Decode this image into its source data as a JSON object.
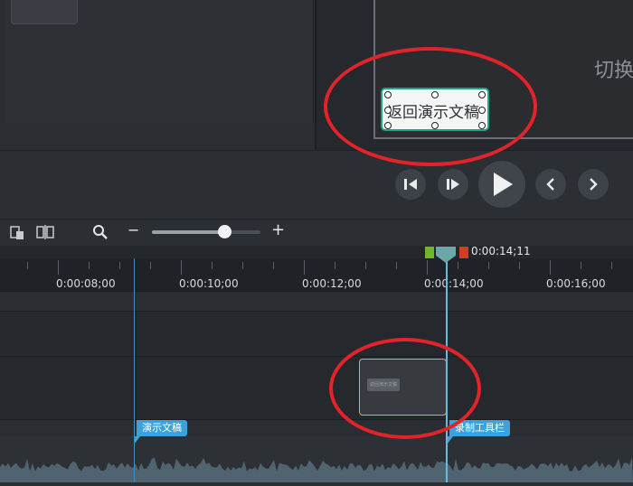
{
  "canvas": {
    "title_partial": "切换",
    "callout_text": "返回演示文稿"
  },
  "playback": {
    "prev_frame": "step-back",
    "next_frame": "step-forward",
    "play": "play",
    "prev_marker": "chevron-left",
    "next_marker": "chevron-right"
  },
  "toolbar": {
    "zoom_out_label": "−",
    "zoom_in_label": "+",
    "zoom_level": 0.62
  },
  "timeline": {
    "playhead_time": "0:00:14;11",
    "ruler_labels": [
      "0:00:08;00",
      "0:00:10;00",
      "0:00:12;00",
      "0:00:14;00",
      "0:00:16;00"
    ],
    "clip_thumb_text": "返回演示文稿",
    "markers": [
      "演示文稿",
      "录制工具栏"
    ]
  },
  "colors": {
    "callout_border": "#21a38a",
    "annotation_red": "#e3232a",
    "marker_blue": "#3aa3dc",
    "clip_border": "#c9b54a",
    "in_point": "#6fb62b",
    "out_point": "#d53a2b"
  }
}
